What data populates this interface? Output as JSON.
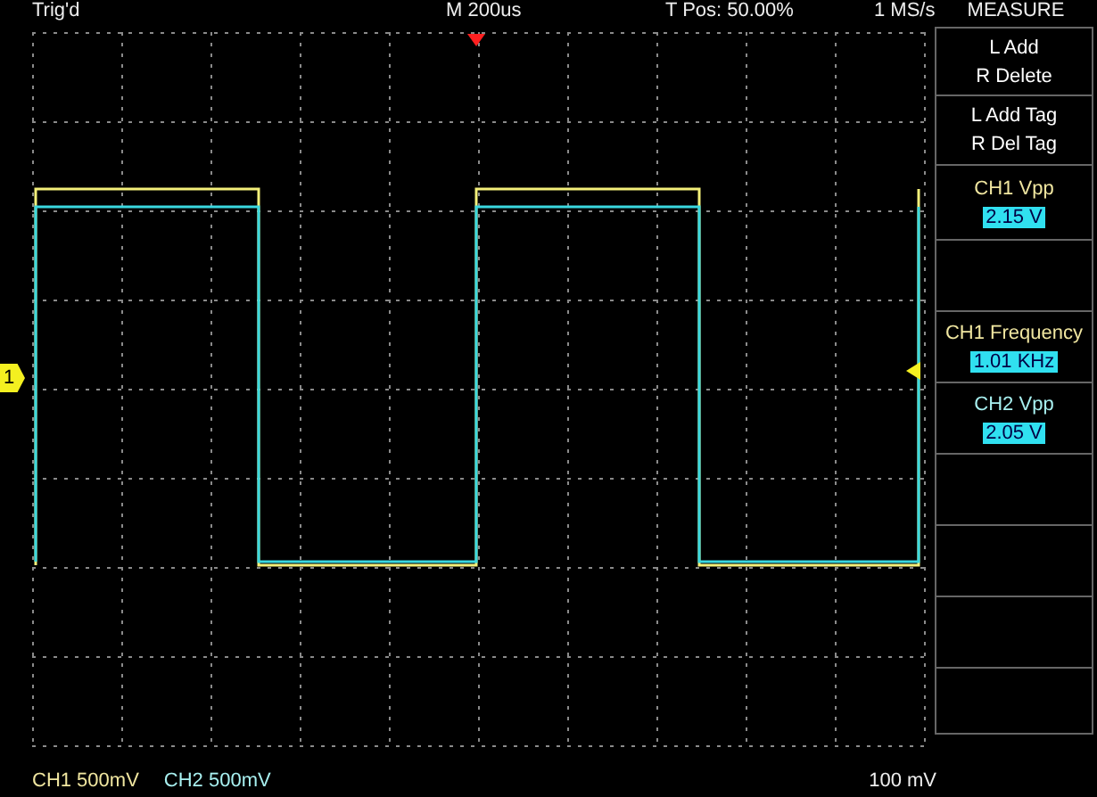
{
  "status_bar": {
    "trigger_state": "Trig'd",
    "timebase": "M 200us",
    "trigger_position": "T Pos: 50.00%",
    "sample_rate": "1 MS/s"
  },
  "screen": {
    "channel_marker": "1"
  },
  "measure_panel": {
    "title": "MEASURE",
    "items": [
      {
        "kind": "button",
        "lines": [
          "L Add",
          "R Delete"
        ]
      },
      {
        "kind": "button",
        "lines": [
          "L Add Tag",
          "R Del Tag"
        ]
      },
      {
        "kind": "measurement",
        "label": "CH1 Vpp",
        "value": "2.15 V",
        "color": "#f0e6a0"
      },
      {
        "kind": "empty"
      },
      {
        "kind": "measurement",
        "label": "CH1 Frequency",
        "value": "1.01 KHz",
        "color": "#f0e6a0"
      },
      {
        "kind": "measurement",
        "label": "CH2 Vpp",
        "value": "2.05 V",
        "color": "#a8f0f0"
      },
      {
        "kind": "empty"
      },
      {
        "kind": "empty"
      },
      {
        "kind": "empty"
      },
      {
        "kind": "empty"
      }
    ]
  },
  "footer": {
    "channels": [
      {
        "text": "CH1  500mV",
        "color": "#f0e6a0"
      },
      {
        "text": "CH2  500mV",
        "color": "#a8f0f0"
      }
    ],
    "trigger_level": "100 mV"
  }
}
